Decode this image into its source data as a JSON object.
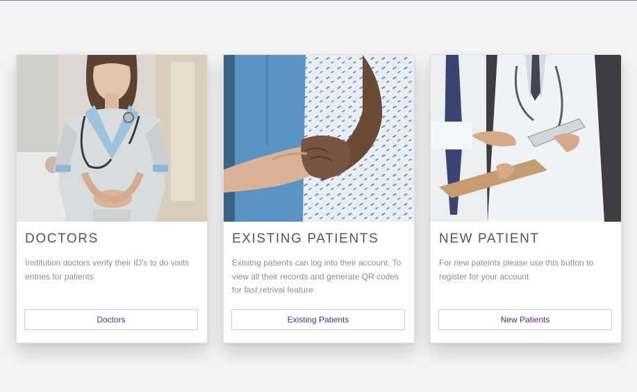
{
  "colors": {
    "page_background": "#f4f4f4",
    "card_background": "#ffffff",
    "title_text": "#555555",
    "body_text": "#8f8f8f",
    "button_text": "#5b2d7f",
    "button_border": "#cccccc"
  },
  "cards": [
    {
      "title": "DOCTORS",
      "description": "Institution doctors verify their ID's to do visits entries for patients",
      "button_label": "Doctors",
      "image_alt": "Doctor in uniform with stethoscope"
    },
    {
      "title": "EXISTING PATIENTS",
      "description": "Exisitng patients can log into their account. To view all their records and generate QR codes for fast retrival feature",
      "button_label": "Existing Patients",
      "image_alt": "Patient holding hands with a caregiver"
    },
    {
      "title": "NEW PATIENT",
      "description": "For new pateints please use this button to register for your account",
      "button_label": "New Patients",
      "image_alt": "Doctors reviewing a clipboard"
    }
  ]
}
